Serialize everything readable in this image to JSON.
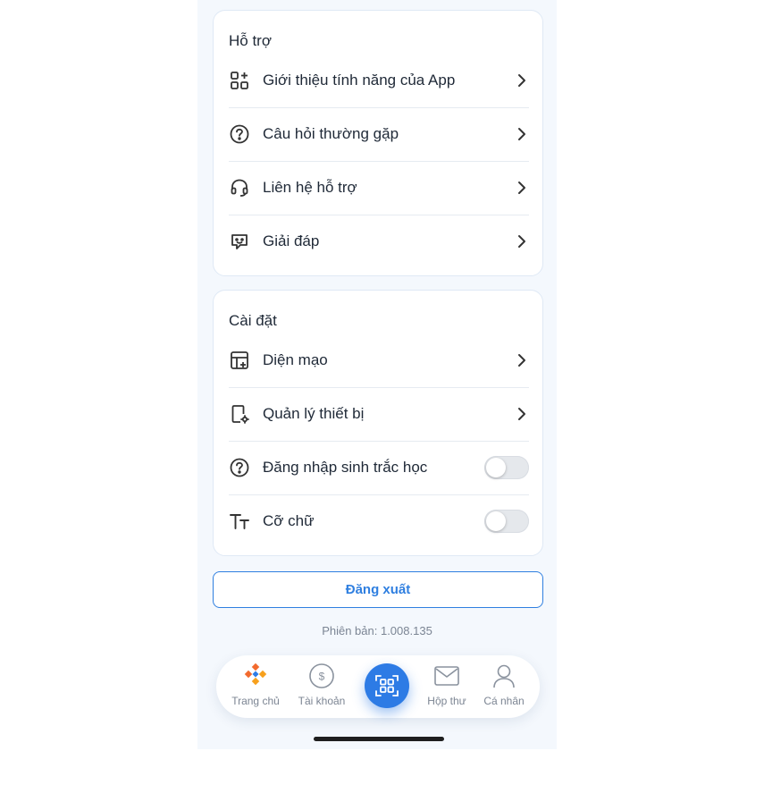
{
  "support": {
    "title": "Hỗ trợ",
    "items": [
      {
        "label": "Giới thiệu tính năng của App",
        "icon": "app-features-icon"
      },
      {
        "label": "Câu hỏi thường gặp",
        "icon": "question-circle-icon"
      },
      {
        "label": "Liên hệ hỗ trợ",
        "icon": "headset-icon"
      },
      {
        "label": "Giải đáp",
        "icon": "chat-bubble-icon"
      }
    ]
  },
  "settings": {
    "title": "Cài đặt",
    "items": [
      {
        "label": "Diện mạo",
        "icon": "appearance-icon",
        "control": "chevron"
      },
      {
        "label": "Quản lý thiết bị",
        "icon": "device-settings-icon",
        "control": "chevron"
      },
      {
        "label": "Đăng nhập sinh trắc học",
        "icon": "question-circle-icon",
        "control": "toggle",
        "on": false
      },
      {
        "label": "Cỡ chữ",
        "icon": "text-size-icon",
        "control": "toggle",
        "on": false
      }
    ]
  },
  "logout_label": "Đăng xuất",
  "version": "Phiên bản: 1.008.135",
  "tabbar": {
    "tabs": [
      {
        "label": "Trang chủ",
        "icon": "home-logo-icon"
      },
      {
        "label": "Tài khoản",
        "icon": "dollar-coin-icon"
      },
      {
        "label": "",
        "icon": "qr-scan-icon"
      },
      {
        "label": "Hộp thư",
        "icon": "mail-icon"
      },
      {
        "label": "Cá nhân",
        "icon": "user-icon"
      }
    ]
  },
  "colors": {
    "accent": "#2f7fe0",
    "background": "#f4f8fd",
    "text": "#1f2937",
    "muted": "#7c8593"
  }
}
